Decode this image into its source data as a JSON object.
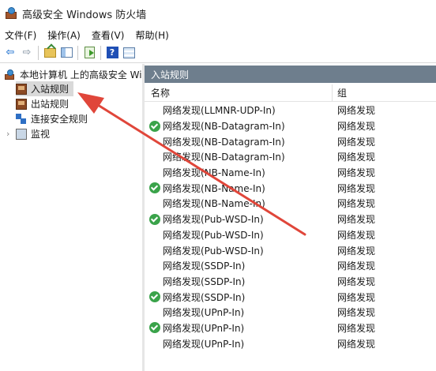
{
  "window": {
    "title": "高级安全 Windows 防火墙"
  },
  "menu": [
    "文件(F)",
    "操作(A)",
    "查看(V)",
    "帮助(H)"
  ],
  "toolbar": {
    "icons": [
      "back-arrow-icon",
      "forward-arrow-icon",
      "up-folder-icon",
      "show-hide-pane-icon",
      "export-list-icon",
      "help-icon",
      "properties-icon"
    ],
    "back_glyph": "⇦",
    "forward_glyph": "⇨",
    "help_glyph": "?"
  },
  "tree": {
    "root_label": "本地计算机 上的高级安全 Wind",
    "items": [
      {
        "label": "入站规则",
        "selected": true
      },
      {
        "label": "出站规则",
        "selected": false
      },
      {
        "label": "连接安全规则",
        "selected": false
      },
      {
        "label": "监视",
        "selected": false
      }
    ],
    "expander_glyph": "›"
  },
  "main": {
    "section_title": "入站规则",
    "columns": {
      "name": "名称",
      "group": "组"
    },
    "rows": [
      {
        "name": "网络发现(LLMNR-UDP-In)",
        "group": "网络发现",
        "enabled": false
      },
      {
        "name": "网络发现(NB-Datagram-In)",
        "group": "网络发现",
        "enabled": true
      },
      {
        "name": "网络发现(NB-Datagram-In)",
        "group": "网络发现",
        "enabled": false
      },
      {
        "name": "网络发现(NB-Datagram-In)",
        "group": "网络发现",
        "enabled": false
      },
      {
        "name": "网络发现(NB-Name-In)",
        "group": "网络发现",
        "enabled": false
      },
      {
        "name": "网络发现(NB-Name-In)",
        "group": "网络发现",
        "enabled": true
      },
      {
        "name": "网络发现(NB-Name-In)",
        "group": "网络发现",
        "enabled": false
      },
      {
        "name": "网络发现(Pub-WSD-In)",
        "group": "网络发现",
        "enabled": true
      },
      {
        "name": "网络发现(Pub-WSD-In)",
        "group": "网络发现",
        "enabled": false
      },
      {
        "name": "网络发现(Pub-WSD-In)",
        "group": "网络发现",
        "enabled": false
      },
      {
        "name": "网络发现(SSDP-In)",
        "group": "网络发现",
        "enabled": false
      },
      {
        "name": "网络发现(SSDP-In)",
        "group": "网络发现",
        "enabled": false
      },
      {
        "name": "网络发现(SSDP-In)",
        "group": "网络发现",
        "enabled": true
      },
      {
        "name": "网络发现(UPnP-In)",
        "group": "网络发现",
        "enabled": false
      },
      {
        "name": "网络发现(UPnP-In)",
        "group": "网络发现",
        "enabled": true
      },
      {
        "name": "网络发现(UPnP-In)",
        "group": "网络发现",
        "enabled": false
      }
    ]
  },
  "colors": {
    "section_header_bg": "#6e7e8d",
    "selected_row_bg": "#d9d9d9",
    "enabled_check": "#3aa34a",
    "annotation_arrow": "#e0463a"
  }
}
